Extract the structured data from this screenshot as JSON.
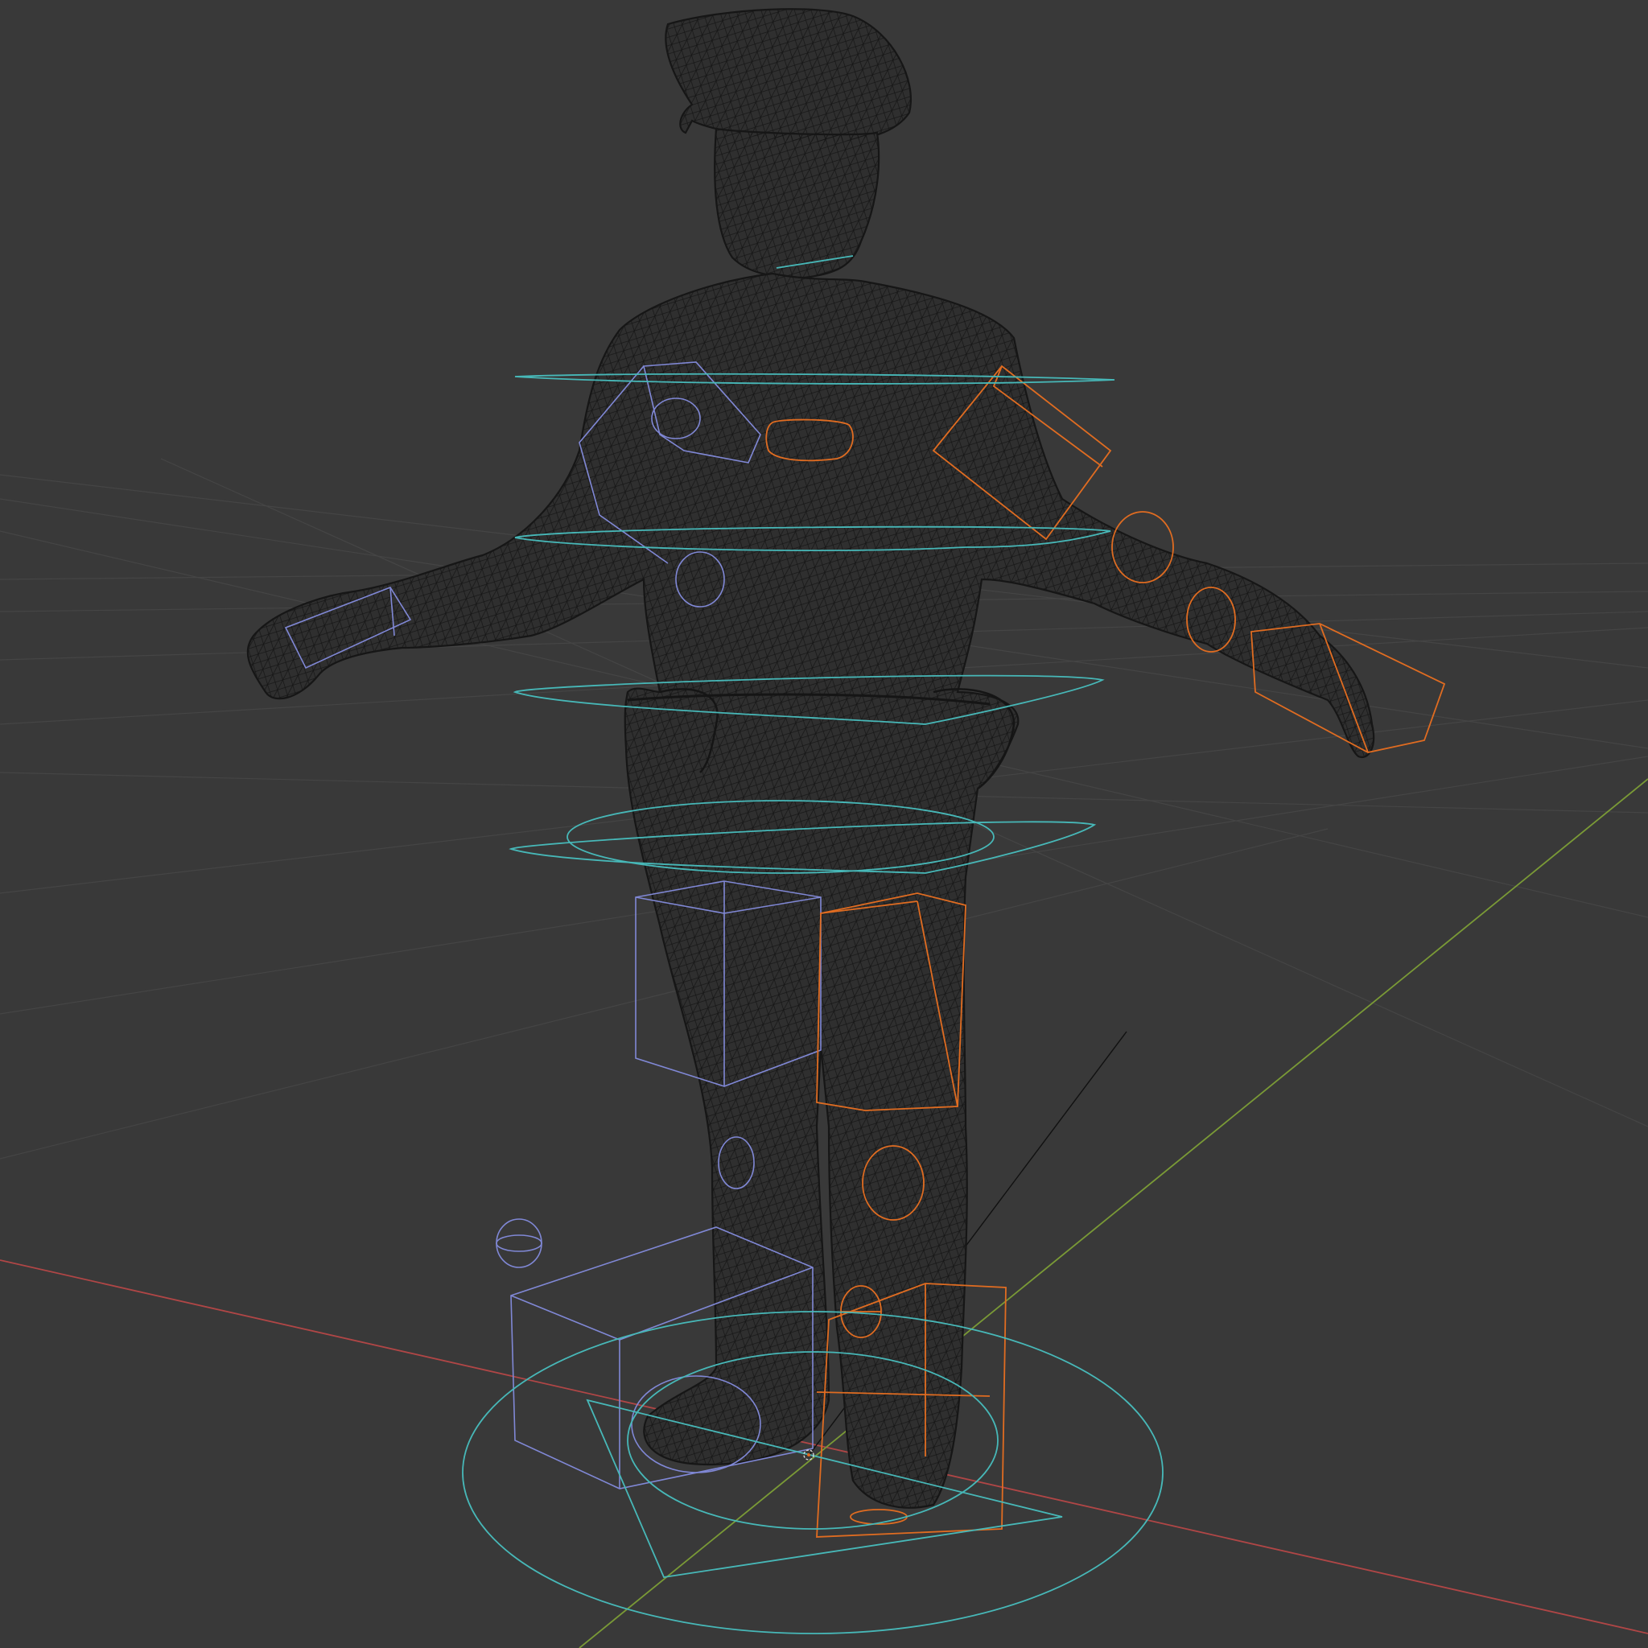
{
  "viewport": {
    "background": "#393939",
    "grid_color": "#454545",
    "x_axis_color": "#b04646",
    "y_axis_color": "#7a9a36",
    "shading": "wireframe"
  },
  "scene": {
    "mesh_color": "#161616",
    "selected_controls_color": "#e06c21",
    "left_controls_color": "#8088d6",
    "center_controls_color": "#47b8b8"
  }
}
